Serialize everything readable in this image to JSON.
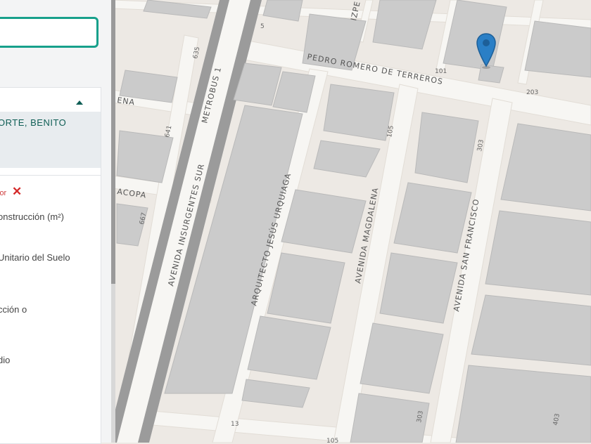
{
  "map": {
    "streets": {
      "pedro_romero": "PEDRO ROMERO DE TERREROS",
      "insurgentes": "AVENIDA INSURGENTES SUR",
      "metrobus": "METROBUS 1",
      "urquiaga": "ARQUITECTO JESÚS URQUIAGA",
      "magdalena": "AVENIDA MAGDALENA",
      "san_francisco": "AVENIDA SAN FRANCISCO",
      "ena": "ENA",
      "acopa": "ACOPA",
      "izpe": "IZPE"
    },
    "numbers": {
      "n635": "635",
      "n641": "641",
      "n667": "667",
      "n101": "101",
      "n203": "203",
      "n105": "105",
      "n303": "303",
      "n303b": "303",
      "n13": "13",
      "n5": "5",
      "n105b": "105",
      "n403": "403"
    },
    "marker_icon": "location-pin-icon",
    "marker_color": "#2a7fc6"
  },
  "panel": {
    "search": {
      "value": ""
    },
    "result": {
      "title_line1": "ORTE, BENITO"
    },
    "filter": {
      "label": "lor",
      "clear_icon": "close-icon"
    },
    "fields": {
      "f1": "onstrucción (m²)",
      "f2": "Unitario del Suelo",
      "f3": "cción o",
      "f4": "dio"
    },
    "accent_color": "#17a08b"
  }
}
